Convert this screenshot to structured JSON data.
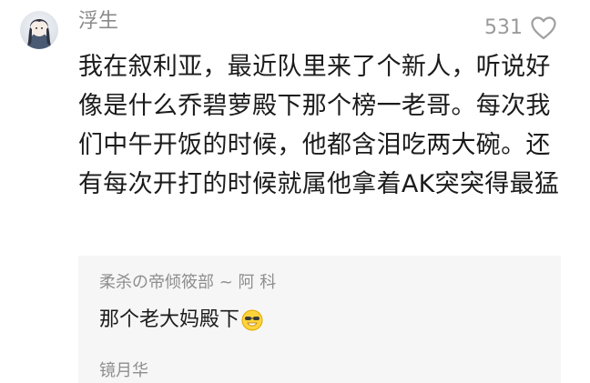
{
  "comment": {
    "author": "浮生",
    "like_count": "531",
    "text": "我在叙利亚，最近队里来了个新人，听说好像是什么乔碧萝殿下那个榜一老哥。每次我们中午开饭的时候，他都含泪吃两大碗。还有每次开打的时候就属他拿着AK突突得最猛"
  },
  "replies": [
    {
      "meta": "柔杀の帝倾筱部 ~ 阿 科",
      "text": "那个老大妈殿下",
      "emoji": "grinning-sunglasses-emoji"
    },
    {
      "meta": "镜月华"
    }
  ],
  "icons": {
    "like": "heart-outline-icon",
    "avatar": "anime-character-avatar"
  },
  "colors": {
    "text": "#1b1b1b",
    "muted": "#8a8a8a",
    "reply_bg": "#f6f6f6"
  }
}
